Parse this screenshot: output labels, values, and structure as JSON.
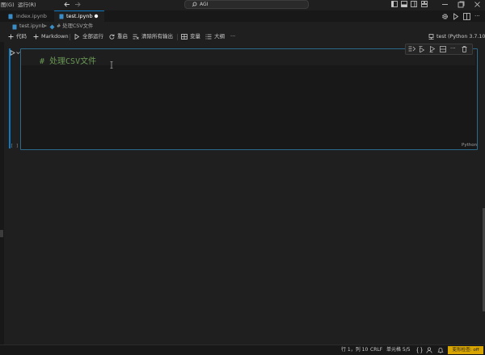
{
  "titlebar": {
    "menu_view": "图(G)",
    "menu_run": "运行(R)",
    "search": "AGI"
  },
  "tabs": [
    {
      "label": "index.ipynb",
      "active": false
    },
    {
      "label": "test.ipynb",
      "active": true,
      "modified": true
    }
  ],
  "breadcrumb": {
    "file": "test.ipynb",
    "separator": ">",
    "section": "# 处理CSV文件"
  },
  "toolbar": {
    "add_code": "代码",
    "add_markdown": "Markdown",
    "run_all": "全部运行",
    "restart": "重启",
    "clear_outputs": "清除所有输出",
    "variables": "变量",
    "outline": "大纲",
    "more": "···",
    "kernel": "test (Python 3.7.10)"
  },
  "cell": {
    "code": "# 处理CSV文件",
    "language": "Python",
    "exec_count": "[ ]"
  },
  "status": {
    "position": "行 1，列 10",
    "eol": "CRLF",
    "cell_info": "单元格 5/5",
    "extension_state": "变形检查: off"
  },
  "colors": {
    "accent": "#0b7ac4",
    "cell_border": "#2b6a8a",
    "comment": "#6a9955",
    "status_badge": "#d7a400"
  }
}
